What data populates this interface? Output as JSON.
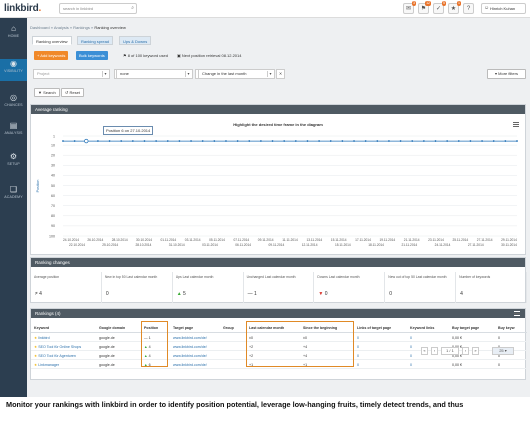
{
  "topbar": {
    "logo_text": "linkbird",
    "search_placeholder": "search in linkbird",
    "icons": [
      {
        "name": "mail-icon",
        "glyph": "✉",
        "badge": "3"
      },
      {
        "name": "flag-icon",
        "glyph": "⚑",
        "badge": "12"
      },
      {
        "name": "check-icon",
        "glyph": "✓",
        "badge": "5"
      },
      {
        "name": "star-icon",
        "glyph": "★",
        "badge": "1"
      },
      {
        "name": "help-icon",
        "glyph": "?",
        "badge": ""
      }
    ],
    "user_name": "Hinrich Kuhan"
  },
  "sidebar": {
    "items": [
      {
        "label": "HOME",
        "icon": "home-icon",
        "glyph": "⌂"
      },
      {
        "label": "VISIBILITY",
        "icon": "eye-icon",
        "glyph": "◉"
      },
      {
        "label": "CHANCES",
        "icon": "target-icon",
        "glyph": "◎"
      },
      {
        "label": "ANALYSIS",
        "icon": "bar-chart-icon",
        "glyph": "▤"
      },
      {
        "label": "SETUP",
        "icon": "gear-icon",
        "glyph": "⚙"
      },
      {
        "label": "ACADEMY",
        "icon": "book-icon",
        "glyph": "❑"
      }
    ]
  },
  "breadcrumb": {
    "items": [
      "Dashboard",
      "Analysis",
      "Rankings",
      "Ranking overview"
    ]
  },
  "tabs": [
    "Ranking overview",
    "Ranking spread",
    "Ups & Downs"
  ],
  "actions": {
    "add_keywords": "+ Add keywords",
    "bulk_keywords": "Bulk keywords",
    "keyword_count": "8 of 100 keyword used",
    "next_retrieval": "Next position retrieval 08.12.2014"
  },
  "filters": {
    "project_placeholder": "Project",
    "filter2_value": "none",
    "period_value": "Change in the last month",
    "more_filters": "More filters"
  },
  "buttons": {
    "search": "Search",
    "reset": "Reset"
  },
  "average_ranking": {
    "title": "Average ranking",
    "chart_title": "Highlight the desired time frame in the diagram",
    "tooltip": "Position 6 on 27.10.2014",
    "y_axis_label": "Position"
  },
  "chart_data": {
    "type": "line",
    "title": "Highlight the desired time frame in the diagram",
    "ylabel": "Position",
    "y_ticks": [
      1,
      10,
      20,
      30,
      40,
      50,
      60,
      70,
      80,
      90,
      100
    ],
    "ylim": [
      1,
      100
    ],
    "y_reversed": true,
    "x_ticks_top": [
      "24.10.2014",
      "26.10.2014",
      "28.10.2014",
      "30.10.2014",
      "01.11.2014",
      "03.11.2014",
      "05.11.2014",
      "07.11.2014",
      "09.11.2014",
      "11.11.2014",
      "13.11.2014",
      "15.11.2014",
      "17.11.2014",
      "19.11.2014",
      "21.11.2014",
      "23.11.2014",
      "25.11.2014",
      "27.11.2014",
      "29.11.2014"
    ],
    "x_ticks_bottom": [
      "22.10.2014",
      "25.10.2014",
      "28.10.2014",
      "31.10.2014",
      "03.11.2014",
      "06.11.2014",
      "09.11.2014",
      "12.11.2014",
      "15.11.2014",
      "18.11.2014",
      "21.11.2014",
      "24.11.2014",
      "27.11.2014",
      "30.11.2014"
    ],
    "series": [
      {
        "values": [
          6,
          6,
          6,
          6,
          6,
          6,
          6,
          6,
          6,
          6,
          6,
          6,
          6,
          6,
          6,
          6,
          6,
          6,
          6,
          6,
          6,
          6,
          6,
          6,
          6,
          6,
          6,
          6,
          6,
          6,
          6,
          6,
          6,
          6,
          6,
          6,
          6,
          6,
          6,
          6
        ]
      }
    ],
    "grid": true,
    "highlight_index": 2
  },
  "ranking_changes": {
    "title": "Ranking changes",
    "columns": [
      {
        "label": "Average position",
        "value": "4",
        "arrow": "eq",
        "glyph": "≠"
      },
      {
        "label": "New in top 50 Last calendar month",
        "value": "0",
        "arrow": "none",
        "glyph": ""
      },
      {
        "label": "Ups Last calendar month",
        "value": "5",
        "arrow": "up",
        "glyph": "▲"
      },
      {
        "label": "Unchanged Last calendar month",
        "value": "1",
        "arrow": "none",
        "glyph": "—"
      },
      {
        "label": "Downs Last calendar month",
        "value": "0",
        "arrow": "down",
        "glyph": "▼"
      },
      {
        "label": "New out of top 50 Last calendar month",
        "value": "0",
        "arrow": "none",
        "glyph": ""
      },
      {
        "label": "Number of keywords",
        "value": "4",
        "arrow": "none",
        "glyph": ""
      }
    ]
  },
  "rankings": {
    "title": "Rankings (4)",
    "headers": [
      "Keyword",
      "Google domain",
      "Position",
      "Target page",
      "Group",
      "Last calendar month",
      "Since the beginning",
      "Links of target page",
      "Keyword links",
      "Buy target page",
      "Buy keyw"
    ],
    "rows": [
      {
        "keyword": "linkbird",
        "domain": "google.de",
        "pos_glyph": "—",
        "position": "1",
        "target": "www.linkbird.com/de/",
        "group": "",
        "last_month": "±0",
        "since_beginning": "±0",
        "links": "0",
        "kw_links": "0",
        "buy_target": "0,00 €",
        "buy_kw": "0"
      },
      {
        "keyword": "SEO Tool für Online Shops",
        "domain": "google.de",
        "pos_glyph": "▲",
        "position": "4",
        "target": "www.linkbird.com/de/",
        "group": "",
        "last_month": "+2",
        "since_beginning": "+4",
        "links": "0",
        "kw_links": "0",
        "buy_target": "0,00 €",
        "buy_kw": "0"
      },
      {
        "keyword": "SEO Tool für Agenturen",
        "domain": "google.de",
        "pos_glyph": "▲",
        "position": "4",
        "target": "www.linkbird.com/de/",
        "group": "",
        "last_month": "+2",
        "since_beginning": "+4",
        "links": "0",
        "kw_links": "0",
        "buy_target": "0,00 €",
        "buy_kw": "0"
      },
      {
        "keyword": "Linkmanager",
        "domain": "google.de",
        "pos_glyph": "▲",
        "position": "6",
        "target": "www.linkbird.com/de/",
        "group": "",
        "last_month": "+1",
        "since_beginning": "+1",
        "links": "0",
        "kw_links": "0",
        "buy_target": "0,00 €",
        "buy_kw": "0"
      }
    ],
    "pager": {
      "first": "«",
      "prev": "‹",
      "page": "1 / 1",
      "next": "›",
      "last": "»",
      "per_page": "25"
    }
  },
  "caption": "Monitor your rankings with linkbird in order to identify position potential, leverage low-hanging fruits, timely detect trends, and thus"
}
